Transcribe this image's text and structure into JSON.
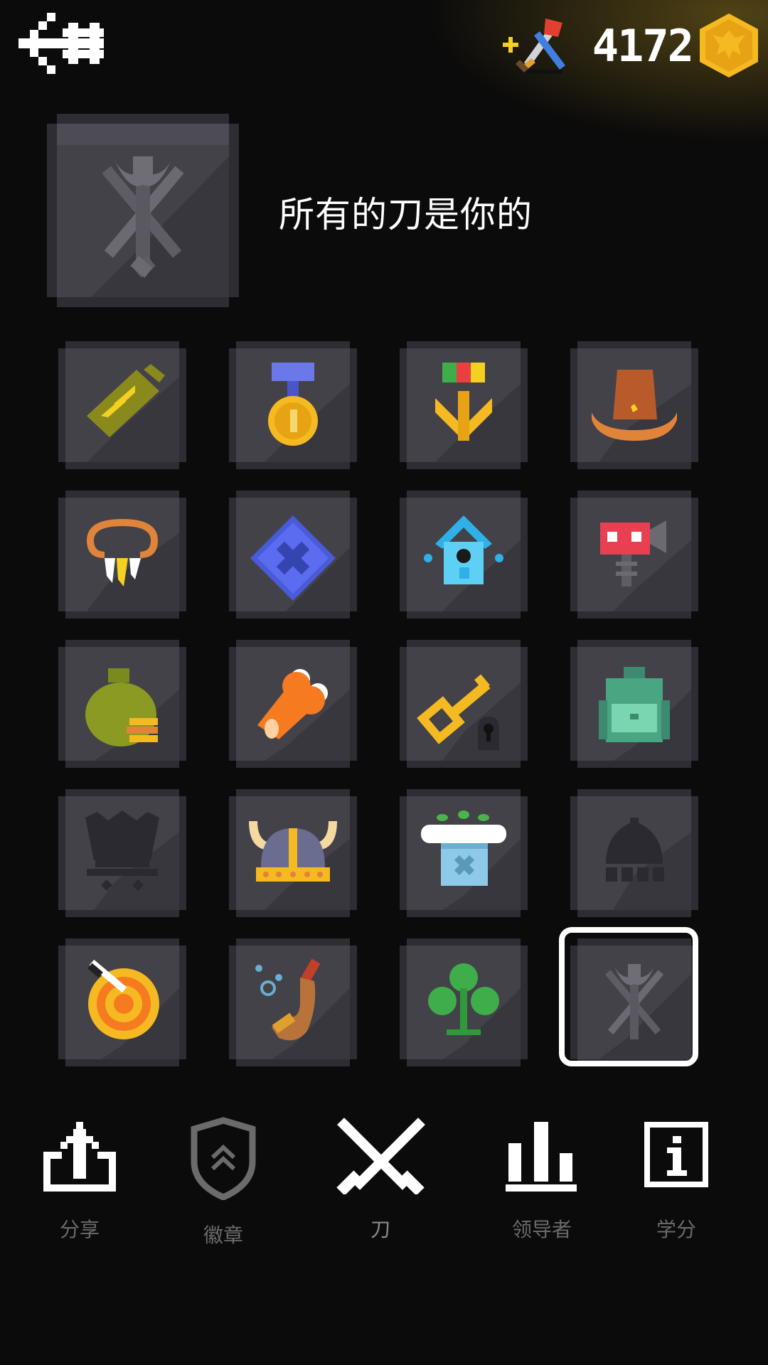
{
  "header": {
    "coin_count": "4172"
  },
  "collection": {
    "title": "所有的刀是你的",
    "selected_index": 19,
    "items": [
      {
        "icon": "military-rank-patch-icon"
      },
      {
        "icon": "gold-medal-icon"
      },
      {
        "icon": "eagle-medal-icon"
      },
      {
        "icon": "cowboy-hat-icon"
      },
      {
        "icon": "tooth-necklace-icon"
      },
      {
        "icon": "blueprint-map-icon"
      },
      {
        "icon": "birdhouse-icon"
      },
      {
        "icon": "robot-head-icon"
      },
      {
        "icon": "money-bag-icon"
      },
      {
        "icon": "bone-meat-icon"
      },
      {
        "icon": "gold-key-lock-icon"
      },
      {
        "icon": "backpack-icon"
      },
      {
        "icon": "dark-crown-locked-icon"
      },
      {
        "icon": "viking-helmet-icon"
      },
      {
        "icon": "plant-shop-icon"
      },
      {
        "icon": "dome-building-locked-icon"
      },
      {
        "icon": "knife-target-icon"
      },
      {
        "icon": "smoking-pipe-icon"
      },
      {
        "icon": "clover-icon"
      },
      {
        "icon": "crossed-weapons-icon"
      }
    ]
  },
  "nav": {
    "share": "分享",
    "badges": "徽章",
    "knives": "刀",
    "leaders": "领导者",
    "credits": "学分"
  },
  "colors": {
    "tile_face": "#434249",
    "tile_edge": "#2e2d33",
    "coin": "#f5b921"
  }
}
